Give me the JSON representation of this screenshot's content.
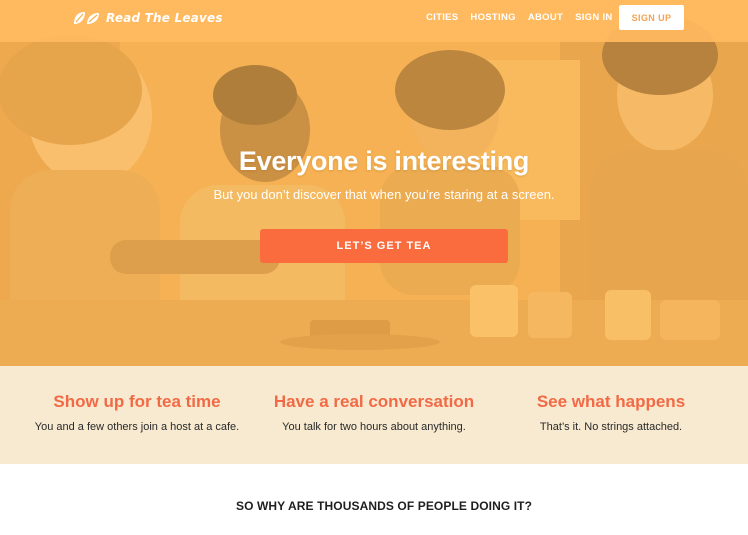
{
  "nav": {
    "logo_text": "Read The Leaves",
    "links": [
      {
        "label": "CITIES"
      },
      {
        "label": "HOSTING"
      },
      {
        "label": "ABOUT"
      },
      {
        "label": "SIGN IN"
      }
    ],
    "signup_label": "SIGN UP"
  },
  "hero": {
    "title": "Everyone is interesting",
    "subtitle": "But you don’t discover that when you’re staring at a screen.",
    "cta_label": "LET’S GET TEA"
  },
  "features": [
    {
      "title": "Show up for tea time",
      "description": "You and a few others join a host at a cafe."
    },
    {
      "title": "Have a real conversation",
      "description": "You talk for two hours about anything."
    },
    {
      "title": "See what happens",
      "description": "That’s it. No strings attached."
    }
  ],
  "why": {
    "heading": "SO WHY ARE THOUSANDS OF PEOPLE DOING IT?"
  },
  "colors": {
    "nav_bg": "#ffba5f",
    "hero_tint": "#ffbe5a",
    "cta": "#fa6b3d",
    "feature_bg": "#f7ead0",
    "feature_title": "#f26a45",
    "signup_text": "#f4a253"
  },
  "icons": {
    "logo": "tea-leaves-icon"
  }
}
